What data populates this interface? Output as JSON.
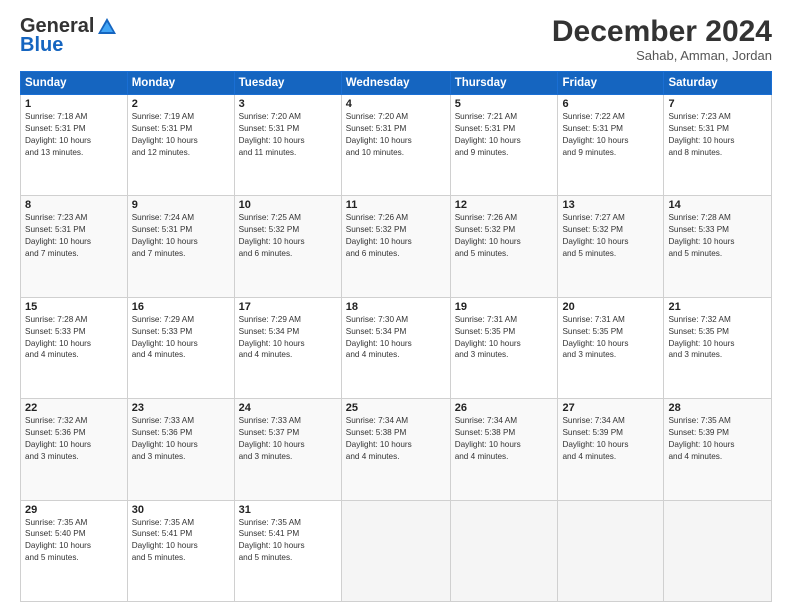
{
  "logo": {
    "line1": "General",
    "line2": "Blue"
  },
  "header": {
    "month": "December 2024",
    "location": "Sahab, Amman, Jordan"
  },
  "days_of_week": [
    "Sunday",
    "Monday",
    "Tuesday",
    "Wednesday",
    "Thursday",
    "Friday",
    "Saturday"
  ],
  "weeks": [
    [
      {
        "day": "1",
        "info": "Sunrise: 7:18 AM\nSunset: 5:31 PM\nDaylight: 10 hours\nand 13 minutes."
      },
      {
        "day": "2",
        "info": "Sunrise: 7:19 AM\nSunset: 5:31 PM\nDaylight: 10 hours\nand 12 minutes."
      },
      {
        "day": "3",
        "info": "Sunrise: 7:20 AM\nSunset: 5:31 PM\nDaylight: 10 hours\nand 11 minutes."
      },
      {
        "day": "4",
        "info": "Sunrise: 7:20 AM\nSunset: 5:31 PM\nDaylight: 10 hours\nand 10 minutes."
      },
      {
        "day": "5",
        "info": "Sunrise: 7:21 AM\nSunset: 5:31 PM\nDaylight: 10 hours\nand 9 minutes."
      },
      {
        "day": "6",
        "info": "Sunrise: 7:22 AM\nSunset: 5:31 PM\nDaylight: 10 hours\nand 9 minutes."
      },
      {
        "day": "7",
        "info": "Sunrise: 7:23 AM\nSunset: 5:31 PM\nDaylight: 10 hours\nand 8 minutes."
      }
    ],
    [
      {
        "day": "8",
        "info": "Sunrise: 7:23 AM\nSunset: 5:31 PM\nDaylight: 10 hours\nand 7 minutes."
      },
      {
        "day": "9",
        "info": "Sunrise: 7:24 AM\nSunset: 5:31 PM\nDaylight: 10 hours\nand 7 minutes."
      },
      {
        "day": "10",
        "info": "Sunrise: 7:25 AM\nSunset: 5:32 PM\nDaylight: 10 hours\nand 6 minutes."
      },
      {
        "day": "11",
        "info": "Sunrise: 7:26 AM\nSunset: 5:32 PM\nDaylight: 10 hours\nand 6 minutes."
      },
      {
        "day": "12",
        "info": "Sunrise: 7:26 AM\nSunset: 5:32 PM\nDaylight: 10 hours\nand 5 minutes."
      },
      {
        "day": "13",
        "info": "Sunrise: 7:27 AM\nSunset: 5:32 PM\nDaylight: 10 hours\nand 5 minutes."
      },
      {
        "day": "14",
        "info": "Sunrise: 7:28 AM\nSunset: 5:33 PM\nDaylight: 10 hours\nand 5 minutes."
      }
    ],
    [
      {
        "day": "15",
        "info": "Sunrise: 7:28 AM\nSunset: 5:33 PM\nDaylight: 10 hours\nand 4 minutes."
      },
      {
        "day": "16",
        "info": "Sunrise: 7:29 AM\nSunset: 5:33 PM\nDaylight: 10 hours\nand 4 minutes."
      },
      {
        "day": "17",
        "info": "Sunrise: 7:29 AM\nSunset: 5:34 PM\nDaylight: 10 hours\nand 4 minutes."
      },
      {
        "day": "18",
        "info": "Sunrise: 7:30 AM\nSunset: 5:34 PM\nDaylight: 10 hours\nand 4 minutes."
      },
      {
        "day": "19",
        "info": "Sunrise: 7:31 AM\nSunset: 5:35 PM\nDaylight: 10 hours\nand 3 minutes."
      },
      {
        "day": "20",
        "info": "Sunrise: 7:31 AM\nSunset: 5:35 PM\nDaylight: 10 hours\nand 3 minutes."
      },
      {
        "day": "21",
        "info": "Sunrise: 7:32 AM\nSunset: 5:35 PM\nDaylight: 10 hours\nand 3 minutes."
      }
    ],
    [
      {
        "day": "22",
        "info": "Sunrise: 7:32 AM\nSunset: 5:36 PM\nDaylight: 10 hours\nand 3 minutes."
      },
      {
        "day": "23",
        "info": "Sunrise: 7:33 AM\nSunset: 5:36 PM\nDaylight: 10 hours\nand 3 minutes."
      },
      {
        "day": "24",
        "info": "Sunrise: 7:33 AM\nSunset: 5:37 PM\nDaylight: 10 hours\nand 3 minutes."
      },
      {
        "day": "25",
        "info": "Sunrise: 7:34 AM\nSunset: 5:38 PM\nDaylight: 10 hours\nand 4 minutes."
      },
      {
        "day": "26",
        "info": "Sunrise: 7:34 AM\nSunset: 5:38 PM\nDaylight: 10 hours\nand 4 minutes."
      },
      {
        "day": "27",
        "info": "Sunrise: 7:34 AM\nSunset: 5:39 PM\nDaylight: 10 hours\nand 4 minutes."
      },
      {
        "day": "28",
        "info": "Sunrise: 7:35 AM\nSunset: 5:39 PM\nDaylight: 10 hours\nand 4 minutes."
      }
    ],
    [
      {
        "day": "29",
        "info": "Sunrise: 7:35 AM\nSunset: 5:40 PM\nDaylight: 10 hours\nand 5 minutes."
      },
      {
        "day": "30",
        "info": "Sunrise: 7:35 AM\nSunset: 5:41 PM\nDaylight: 10 hours\nand 5 minutes."
      },
      {
        "day": "31",
        "info": "Sunrise: 7:35 AM\nSunset: 5:41 PM\nDaylight: 10 hours\nand 5 minutes."
      },
      {
        "day": "",
        "info": ""
      },
      {
        "day": "",
        "info": ""
      },
      {
        "day": "",
        "info": ""
      },
      {
        "day": "",
        "info": ""
      }
    ]
  ]
}
